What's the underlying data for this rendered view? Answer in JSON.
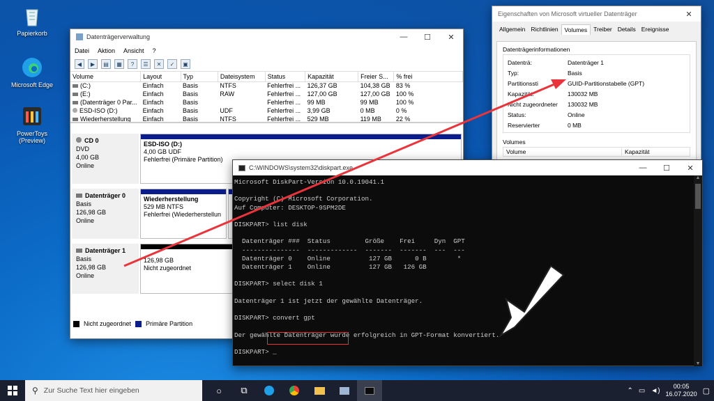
{
  "desktop": {
    "icons": [
      {
        "label": "Papierkorb"
      },
      {
        "label": "Microsoft Edge"
      },
      {
        "label": "PowerToys (Preview)"
      }
    ]
  },
  "diskmgmt": {
    "title": "Datenträgerverwaltung",
    "menu": [
      "Datei",
      "Aktion",
      "Ansicht",
      "?"
    ],
    "columns": [
      "Volume",
      "Layout",
      "Typ",
      "Dateisystem",
      "Status",
      "Kapazität",
      "Freier S...",
      "% frei"
    ],
    "rows": [
      [
        "(C:)",
        "Einfach",
        "Basis",
        "NTFS",
        "Fehlerfrei ...",
        "126,37 GB",
        "104,38 GB",
        "83 %"
      ],
      [
        "(E:)",
        "Einfach",
        "Basis",
        "RAW",
        "Fehlerfrei ...",
        "127,00 GB",
        "127,00 GB",
        "100 %"
      ],
      [
        "(Datenträger 0 Par...",
        "Einfach",
        "Basis",
        "",
        "Fehlerfrei ...",
        "99 MB",
        "99 MB",
        "100 %"
      ],
      [
        "ESD-ISO (D:)",
        "Einfach",
        "Basis",
        "UDF",
        "Fehlerfrei ...",
        "3,99 GB",
        "0 MB",
        "0 %"
      ],
      [
        "Wiederherstellung",
        "Einfach",
        "Basis",
        "NTFS",
        "Fehlerfrei ...",
        "529 MB",
        "119 MB",
        "22 %"
      ]
    ],
    "disks": [
      {
        "name": "CD 0",
        "type": "DVD",
        "size": "4,00 GB",
        "state": "Online",
        "part_name": "ESD-ISO  (D:)",
        "part_l1": "4,00 GB UDF",
        "part_l2": "Fehlerfrei (Primäre Partition)"
      },
      {
        "name": "Datenträger 0",
        "type": "Basis",
        "size": "126,98 GB",
        "state": "Online",
        "part_name": "Wiederherstellung",
        "part_l1": "529 MB NTFS",
        "part_l2": "Fehlerfrei (Wiederherstellun"
      },
      {
        "name": "Datenträger 1",
        "type": "Basis",
        "size": "126,98 GB",
        "state": "Online",
        "part_name": "",
        "part_l1": "126,98 GB",
        "part_l2": "Nicht zugeordnet"
      }
    ],
    "legend": {
      "unallocated": "Nicht zugeordnet",
      "primary": "Primäre Partition"
    }
  },
  "props": {
    "title": "Eigenschaften von Microsoft virtueller Datenträger",
    "tabs": [
      "Allgemein",
      "Richtlinien",
      "Volumes",
      "Treiber",
      "Details",
      "Ereignisse"
    ],
    "group": "Datenträgerinformationen",
    "fields": [
      {
        "k": "Datenträ:",
        "v": "Datenträger 1"
      },
      {
        "k": "Typ:",
        "v": "Basis"
      },
      {
        "k": "Partitionssti",
        "v": "GUID-Partitionstabelle (GPT)"
      },
      {
        "k": "Kapazität:",
        "v": "130032 MB"
      },
      {
        "k": "Nicht zugeordneter",
        "v": "130032 MB"
      },
      {
        "k": "Status:",
        "v": "Online"
      },
      {
        "k": "Reservierter",
        "v": "0 MB"
      }
    ],
    "volumes_label": "Volumes",
    "vol_col1": "Volume",
    "vol_col2": "Kapazität"
  },
  "cmd": {
    "title": "C:\\WINDOWS\\system32\\diskpart.exe",
    "lines": [
      "Microsoft DiskPart-Version 10.0.19041.1",
      "",
      "Copyright (C) Microsoft Corporation.",
      "Auf Computer: DESKTOP-9SPM2DE",
      "",
      "DISKPART> list disk",
      "",
      "  Datenträger ###  Status         Größe    Frei     Dyn  GPT",
      "  ---------------  -------------  -------  -------  ---  ---",
      "  Datenträger 0    Online          127 GB      0 B        *",
      "  Datenträger 1    Online          127 GB   126 GB",
      "",
      "DISKPART> select disk 1",
      "",
      "Datenträger 1 ist jetzt der gewählte Datenträger.",
      "",
      "DISKPART> convert gpt",
      "",
      "Der gewählte Datenträger wurde erfolgreich in GPT-Format konvertiert.",
      "",
      "DISKPART> _"
    ]
  },
  "taskbar": {
    "search_placeholder": "Zur Suche Text hier eingeben",
    "time": "00:05",
    "date": "16.07.2020"
  },
  "colors": {
    "primary_partition": "#0b1d8a",
    "unallocated": "#000000",
    "arrow": "#e8343a",
    "highlight_box": "#e8343a"
  }
}
